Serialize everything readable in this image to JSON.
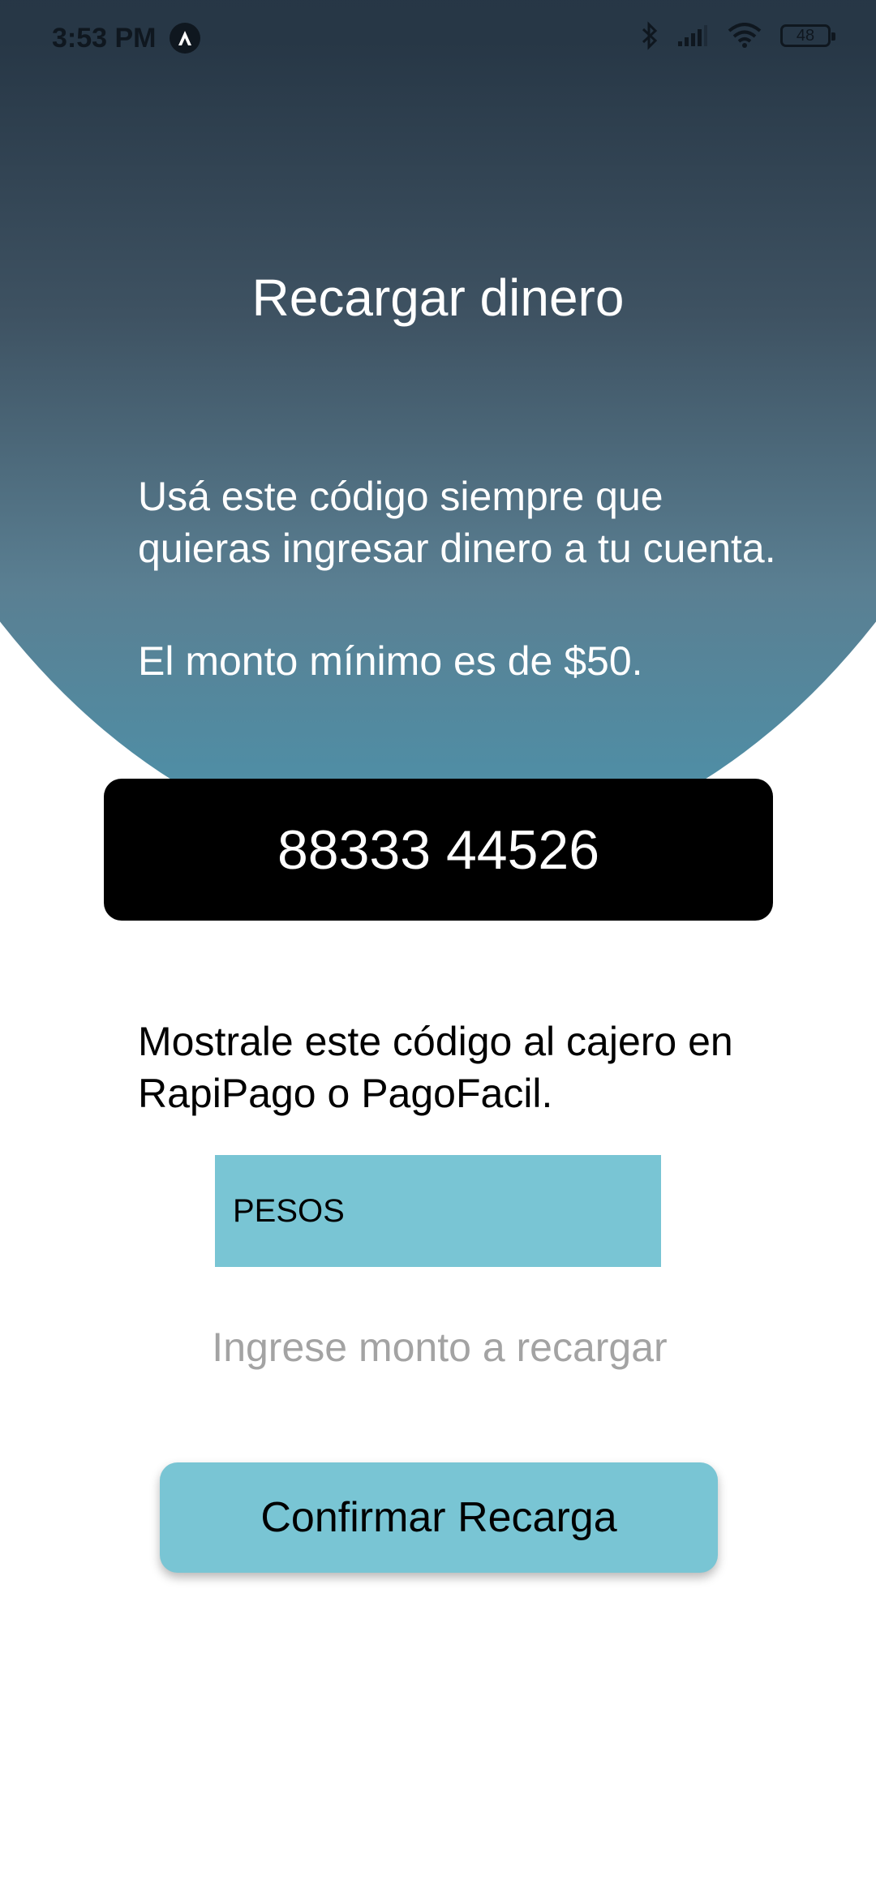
{
  "status_bar": {
    "time": "3:53 PM",
    "battery": "48",
    "icons": [
      "app-notification-icon",
      "bluetooth-icon",
      "signal-icon",
      "wifi-icon",
      "battery-icon"
    ]
  },
  "page": {
    "title": "Recargar dinero",
    "intro": "Usá este código siempre que quieras ingresar dinero a tu cuenta.",
    "min_amount": "El monto mínimo es de $50.",
    "code": "88333 44526",
    "instruction": "Mostrale este código al cajero en RapiPago o PagoFacil."
  },
  "form": {
    "currency_selected": "PESOS",
    "amount_placeholder": "Ingrese monto a recargar",
    "amount_value": "",
    "confirm_label": "Confirmar Recarga"
  },
  "colors": {
    "accent": "#79c5d4",
    "hero_top": "#202f3d",
    "hero_bottom": "#4b94ad",
    "code_background": "#000000"
  }
}
